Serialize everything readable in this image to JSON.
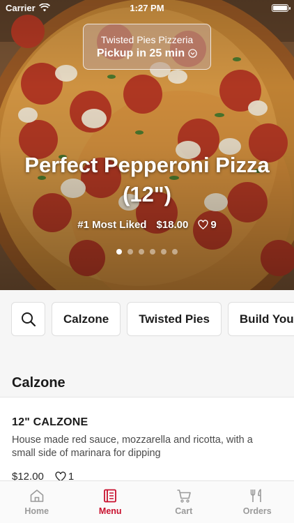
{
  "status_bar": {
    "carrier": "Carrier",
    "time": "1:27 PM"
  },
  "restaurant": {
    "name": "Twisted Pies Pizzeria",
    "pickup": "Pickup in 25 min"
  },
  "featured": {
    "title": "Perfect Pepperoni Pizza (12\")",
    "badge": "#1 Most Liked",
    "price": "$18.00",
    "likes": "9",
    "carousel": {
      "count": 6,
      "active_index": 0
    }
  },
  "categories": {
    "search_icon": "search-icon",
    "items": [
      "Calzone",
      "Twisted Pies",
      "Build Your"
    ]
  },
  "section": {
    "title": "Calzone",
    "items": [
      {
        "name": "12\" CALZONE",
        "description": "House made red sauce, mozzarella and ricotta, with a small side of marinara for dipping",
        "price": "$12.00",
        "likes": "1"
      }
    ]
  },
  "tabbar": {
    "items": [
      {
        "label": "Home",
        "icon": "home-icon",
        "active": false
      },
      {
        "label": "Menu",
        "icon": "menu-icon",
        "active": true
      },
      {
        "label": "Cart",
        "icon": "cart-icon",
        "active": false
      },
      {
        "label": "Orders",
        "icon": "orders-icon",
        "active": false
      }
    ]
  },
  "colors": {
    "accent": "#c8102e",
    "inactive_tab": "#9a9a9a",
    "chip_background": "#f6f6f6"
  }
}
